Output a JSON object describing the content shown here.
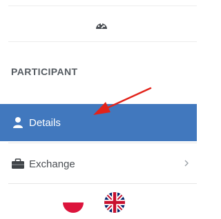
{
  "toolbar": {
    "dashboard_icon": "dashboard-gauge-icon"
  },
  "sidebar": {
    "section_heading": "PARTICIPANT",
    "items": [
      {
        "label": "Details",
        "icon": "user-icon",
        "active": true
      },
      {
        "label": "Exchange",
        "icon": "briefcase-icon",
        "active": false,
        "has_chevron": true
      }
    ]
  },
  "languages": [
    {
      "code": "pl",
      "icon": "poland-flag-icon"
    },
    {
      "code": "en",
      "icon": "uk-flag-icon"
    }
  ],
  "annotation": {
    "icon": "red-arrow-icon",
    "color": "#e2231a"
  },
  "colors": {
    "active_bg": "#4178be",
    "text": "#4b4f54",
    "heading": "#555b61"
  }
}
